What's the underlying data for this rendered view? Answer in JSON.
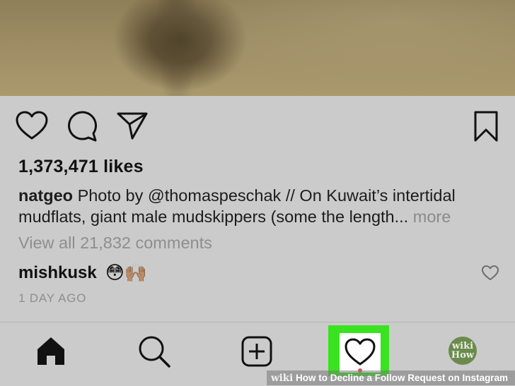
{
  "post": {
    "likes": "1,373,471 likes",
    "caption_user": "natgeo",
    "caption_text": "Photo by @thomaspeschak // On Kuwait’s intertidal mudflats, giant male mudskippers (some the length...",
    "more_label": "more",
    "view_all_comments": "View all 21,832 comments",
    "comment": {
      "user": "mishkusk",
      "text": "😳🙌🏽"
    },
    "timestamp": "1 DAY AGO"
  },
  "icons": {
    "like": "heart-outline-icon",
    "comment": "speech-bubble-icon",
    "share": "paper-plane-icon",
    "save": "bookmark-icon",
    "comment_like": "small-heart-icon"
  },
  "tabbar": {
    "tabs": [
      "home-icon",
      "search-icon",
      "new-post-icon",
      "activity-heart-icon",
      "profile-avatar"
    ],
    "active_highlight_color": "#39e31f",
    "avatar_text_line1": "wiki",
    "avatar_text_line2": "How"
  },
  "watermark": {
    "wiki": "wiki",
    "title": "How to Decline a Follow Request on Instagram"
  }
}
